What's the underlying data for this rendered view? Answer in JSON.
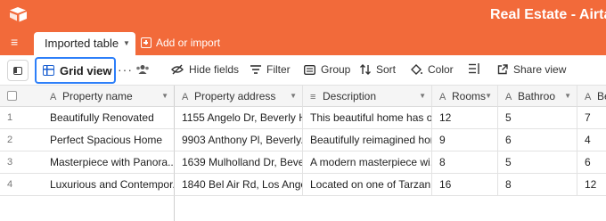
{
  "app": {
    "title": "Real Estate - Airtab",
    "brand_color": "#f26a3a",
    "accent_color": "#2d7ff9"
  },
  "tabs": {
    "active_label": "Imported table",
    "add_label": "Add or import"
  },
  "toolbar": {
    "view_label": "Grid view",
    "more": "···",
    "hide_fields": "Hide fields",
    "filter": "Filter",
    "group": "Group",
    "sort": "Sort",
    "color": "Color",
    "share_view": "Share view"
  },
  "table": {
    "columns": [
      {
        "label": "Property name",
        "icon": "text-field-icon"
      },
      {
        "label": "Property address",
        "icon": "text-field-icon"
      },
      {
        "label": "Description",
        "icon": "long-text-icon"
      },
      {
        "label": "Rooms",
        "icon": "text-field-icon"
      },
      {
        "label": "Bathroo",
        "icon": "text-field-icon"
      },
      {
        "label": "Be",
        "icon": "text-field-icon"
      }
    ],
    "rows": [
      {
        "num": "1",
        "cells": [
          "Beautifully Renovated",
          "1155 Angelo Dr, Beverly H...",
          "This beautiful home has o...",
          "12",
          "5",
          "7"
        ]
      },
      {
        "num": "2",
        "cells": [
          "Perfect Spacious Home",
          "9903 Anthony Pl, Beverly...",
          "Beautifully reimagined hom...",
          "9",
          "6",
          "4"
        ]
      },
      {
        "num": "3",
        "cells": [
          "Masterpiece with Panora...",
          "1639 Mulholland Dr, Beve...",
          "A modern masterpiece wi...",
          "8",
          "5",
          "6"
        ]
      },
      {
        "num": "4",
        "cells": [
          "Luxurious and Contempor...",
          "1840 Bel Air Rd, Los Ange...",
          "Located on one of Tarzan...",
          "16",
          "8",
          "12"
        ]
      }
    ]
  }
}
